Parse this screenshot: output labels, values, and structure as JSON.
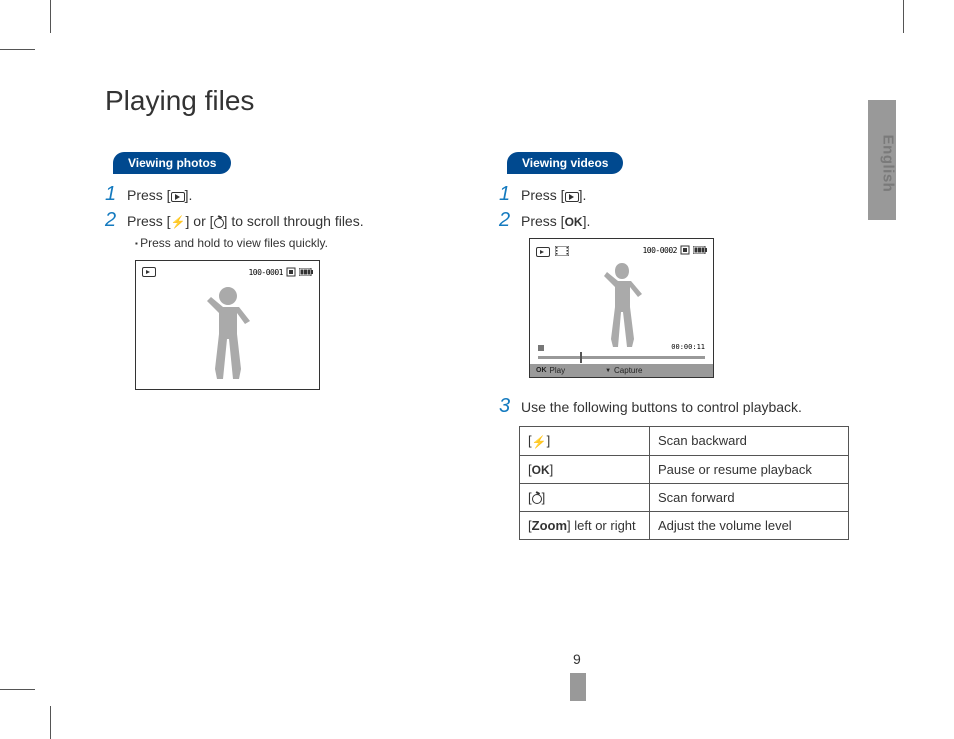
{
  "sideLabel": "English",
  "title": "Playing files",
  "pageNumber": "9",
  "left": {
    "sectionTitle": "Viewing photos",
    "step1a": "Press [",
    "step1b": "].",
    "step2a": "Press [",
    "step2b": "] or [",
    "step2c": "] to scroll through files.",
    "subNote": "Press and hold to view files quickly.",
    "lcdCounter": "100-0001"
  },
  "right": {
    "sectionTitle": "Viewing videos",
    "step1a": "Press [",
    "step1b": "].",
    "step2a": "Press [",
    "step2b": "].",
    "step3": "Use the following buttons to control playback.",
    "lcdCounter": "100-0002",
    "lcdTime": "00:00:11",
    "bbPlay": "Play",
    "bbCapture": "Capture",
    "table": {
      "r1": "Scan backward",
      "r2": "Pause or resume playback",
      "r3": "Scan forward",
      "r4k": "Zoom",
      "r4kSuffix": "] left or right",
      "r4v": "Adjust the volume level"
    }
  }
}
